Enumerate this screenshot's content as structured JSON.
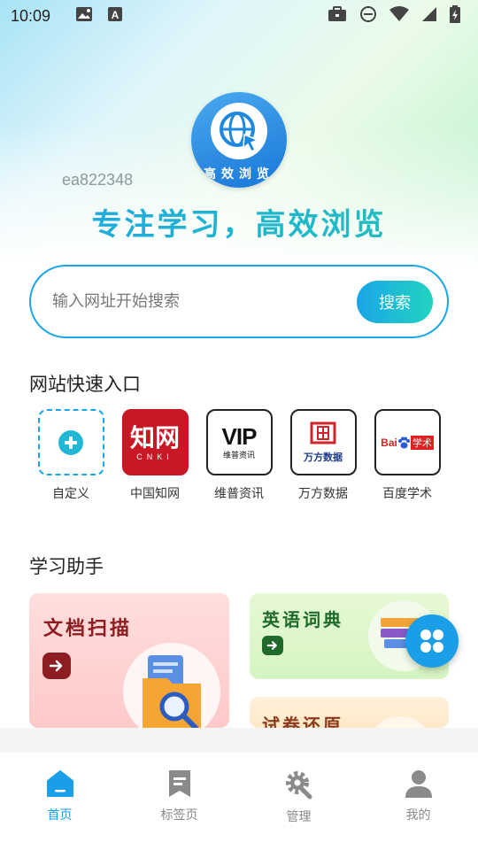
{
  "status_bar": {
    "time": "10:09",
    "icons": [
      "image-icon",
      "font-icon",
      "briefcase-icon",
      "do-not-disturb-icon",
      "wifi-icon",
      "signal-icon",
      "battery-charging-icon"
    ]
  },
  "header": {
    "logo_text": "高效浏览",
    "watermark": "ea822348",
    "slogan": "专注学习，高效浏览"
  },
  "search": {
    "placeholder": "输入网址开始搜索",
    "value": "",
    "button_label": "搜索"
  },
  "quick_links": {
    "title": "网站快速入口",
    "items": [
      {
        "label": "自定义",
        "icon": "add-icon"
      },
      {
        "label": "中国知网",
        "icon": "cnki-logo",
        "logo_text": "知网",
        "logo_sub": "CNKI"
      },
      {
        "label": "维普资讯",
        "icon": "vip-logo",
        "logo_text": "VIP",
        "logo_sub": "维普资讯"
      },
      {
        "label": "万方数据",
        "icon": "wanfang-logo",
        "logo_text": "万方数据"
      },
      {
        "label": "百度学术",
        "icon": "baidu-scholar-logo",
        "logo_text": "Bai",
        "logo_sub": "学术"
      }
    ]
  },
  "study": {
    "title": "学习助手",
    "cards": [
      {
        "title": "文档扫描",
        "color": "#8d1d20"
      },
      {
        "title": "英语词典",
        "color": "#1f6a2a"
      },
      {
        "title": "试卷还原",
        "color": "#8a3a1a"
      }
    ]
  },
  "bottom_nav": {
    "items": [
      {
        "label": "首页",
        "icon": "home-icon",
        "active": true
      },
      {
        "label": "标签页",
        "icon": "bookmark-icon",
        "active": false
      },
      {
        "label": "管理",
        "icon": "settings-icon",
        "active": false
      },
      {
        "label": "我的",
        "icon": "person-icon",
        "active": false
      }
    ]
  },
  "colors": {
    "accent": "#1aa6e8",
    "accent_green": "#22d3c0"
  }
}
